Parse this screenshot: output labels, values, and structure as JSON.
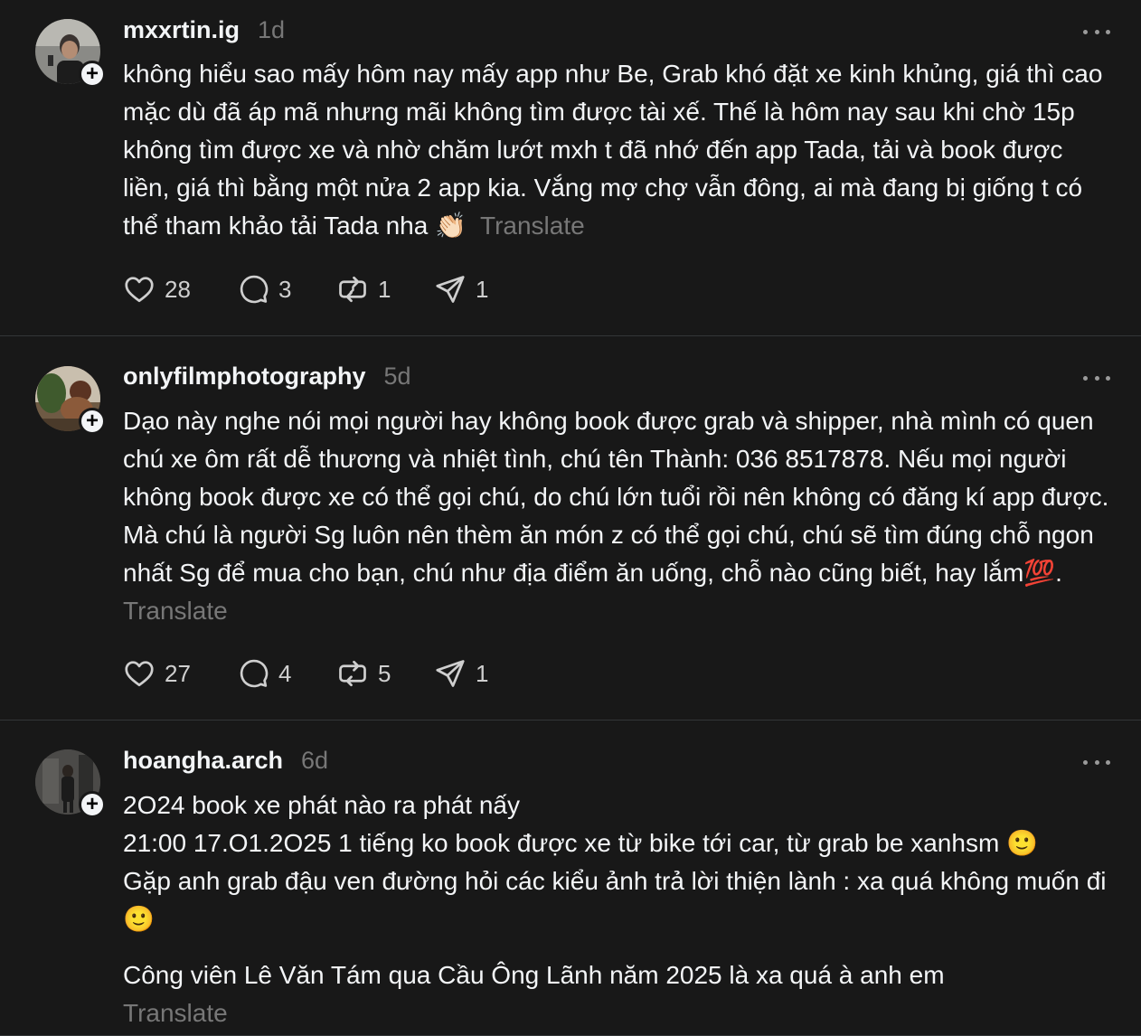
{
  "posts": [
    {
      "username": "mxxrtin.ig",
      "time": "1d",
      "text": "không hiểu sao mấy hôm nay mấy app như Be, Grab khó đặt xe kinh khủng, giá thì cao mặc dù đã áp mã nhưng mãi không tìm được tài xế. Thế là hôm nay sau khi chờ 15p không tìm được xe và nhờ chăm lướt mxh t đã nhớ đến app Tada, tải và book được liền, giá thì bằng một nửa 2 app kia. Vắng mợ chợ vẫn đông, ai mà đang bị giống t có thể tham khảo tải Tada nha 👏🏻",
      "translate": "Translate",
      "likes": "28",
      "replies": "3",
      "reposts": "1",
      "shares": "1"
    },
    {
      "username": "onlyfilmphotography",
      "time": "5d",
      "text": "Dạo này nghe nói mọi người hay không book được grab và shipper, nhà mình có quen chú xe ôm rất dễ thương và nhiệt tình, chú tên Thành: 036 8517878. Nếu mọi người không book được xe có thể gọi chú, do chú lớn tuổi rồi nên không có đăng kí app được. Mà chú là người Sg luôn nên thèm ăn món z có thể gọi chú, chú sẽ tìm đúng chỗ ngon nhất Sg để mua cho bạn, chú như địa điểm ăn uống, chỗ nào cũng biết, hay lắm💯.",
      "translate": "Translate",
      "likes": "27",
      "replies": "4",
      "reposts": "5",
      "shares": "1"
    },
    {
      "username": "hoangha.arch",
      "time": "6d",
      "line1": "2O24 book xe phát nào ra phát nấy",
      "line2": "21:00 17.O1.2O25 1 tiếng ko book được xe từ bike tới car, từ grab be xanhsm 🙂",
      "line3": "Gặp anh grab đậu ven đường hỏi các kiểu ảnh trả lời thiện lành : xa quá không muốn đi 🙂",
      "line4": "Công viên Lê Văn Tám qua Cầu Ông Lãnh năm 2025 là xa quá à anh em",
      "translate": "Translate"
    }
  ]
}
